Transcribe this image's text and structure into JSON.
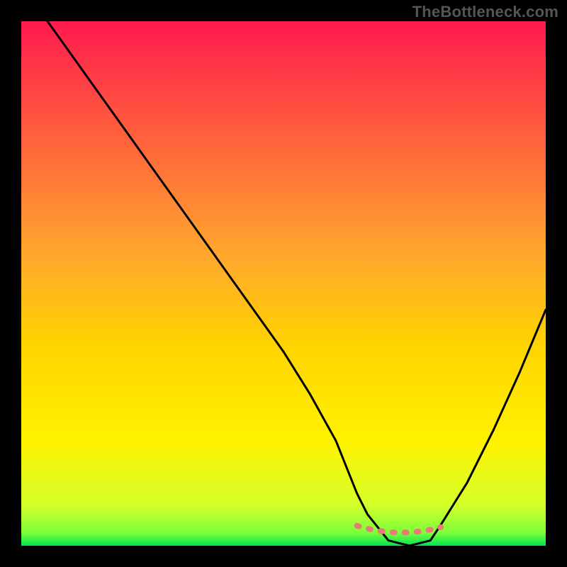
{
  "watermark": "TheBottleneck.com",
  "chart_data": {
    "type": "line",
    "title": "",
    "xlabel": "",
    "ylabel": "",
    "xlim": [
      0,
      100
    ],
    "ylim": [
      0,
      100
    ],
    "grid": false,
    "legend": null,
    "background_gradient_top": "#ff1a4f",
    "background_gradient_mid": "#ffd400",
    "background_gradient_bottom": "#00e552",
    "series": [
      {
        "name": "bottleneck-curve",
        "color": "#000000",
        "x": [
          5,
          10,
          15,
          20,
          25,
          30,
          35,
          40,
          45,
          50,
          55,
          60,
          62,
          64,
          66,
          70,
          74,
          78,
          80,
          85,
          90,
          95,
          100
        ],
        "y": [
          100,
          93,
          86,
          79,
          72,
          65,
          58,
          51,
          44,
          37,
          29,
          20,
          15,
          10,
          6,
          1,
          0,
          1,
          4,
          12,
          22,
          33,
          45
        ]
      }
    ],
    "annotations": [
      {
        "name": "optimal-band",
        "shape": "dashed-pink",
        "color": "#e87a78",
        "x_range": [
          64,
          80
        ],
        "y": 3
      }
    ]
  }
}
